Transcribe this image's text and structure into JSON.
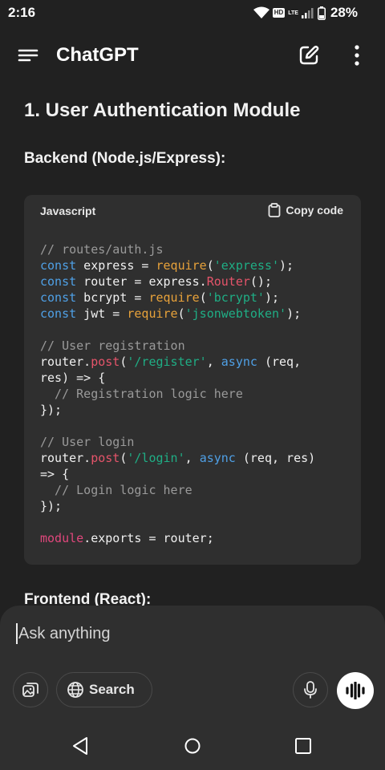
{
  "status_bar": {
    "time": "2:16",
    "hd": "HD",
    "lte": "LTE",
    "battery": "28%",
    "icons": [
      "wifi-icon",
      "signal-icon",
      "battery-icon"
    ]
  },
  "header": {
    "title": "ChatGPT",
    "icons": [
      "menu-icon",
      "new-chat-icon",
      "more-vert-icon"
    ]
  },
  "message": {
    "heading": "1. User Authentication Module",
    "subheading_backend": "Backend (Node.js/Express):",
    "code_block": {
      "language": "Javascript",
      "copy_label": "Copy code",
      "lines": [
        [
          [
            "c",
            "// routes/auth.js"
          ]
        ],
        [
          [
            "k",
            "const"
          ],
          [
            "p",
            " express = "
          ],
          [
            "f",
            "require"
          ],
          [
            "p",
            "("
          ],
          [
            "s",
            "'express'"
          ],
          [
            "p",
            ");"
          ]
        ],
        [
          [
            "k",
            "const"
          ],
          [
            "p",
            " router = express."
          ],
          [
            "r",
            "Router"
          ],
          [
            "p",
            "();"
          ]
        ],
        [
          [
            "k",
            "const"
          ],
          [
            "p",
            " bcrypt = "
          ],
          [
            "f",
            "require"
          ],
          [
            "p",
            "("
          ],
          [
            "s",
            "'bcrypt'"
          ],
          [
            "p",
            ");"
          ]
        ],
        [
          [
            "k",
            "const"
          ],
          [
            "p",
            " jwt = "
          ],
          [
            "f",
            "require"
          ],
          [
            "p",
            "("
          ],
          [
            "s",
            "'jsonwebtoken'"
          ],
          [
            "p",
            ");"
          ]
        ],
        [
          [
            "p",
            ""
          ]
        ],
        [
          [
            "c",
            "// User registration"
          ]
        ],
        [
          [
            "p",
            "router."
          ],
          [
            "r",
            "post"
          ],
          [
            "p",
            "("
          ],
          [
            "s",
            "'/register'"
          ],
          [
            "p",
            ", "
          ],
          [
            "k",
            "async"
          ],
          [
            "p",
            " (req,"
          ]
        ],
        [
          [
            "p",
            "res) => {"
          ]
        ],
        [
          [
            "c",
            "  // Registration logic here"
          ]
        ],
        [
          [
            "p",
            "});"
          ]
        ],
        [
          [
            "p",
            ""
          ]
        ],
        [
          [
            "c",
            "// User login"
          ]
        ],
        [
          [
            "p",
            "router."
          ],
          [
            "r",
            "post"
          ],
          [
            "p",
            "("
          ],
          [
            "s",
            "'/login'"
          ],
          [
            "p",
            ", "
          ],
          [
            "k",
            "async"
          ],
          [
            "p",
            " (req, res)"
          ]
        ],
        [
          [
            "p",
            "=> {"
          ]
        ],
        [
          [
            "c",
            "  // Login logic here"
          ]
        ],
        [
          [
            "p",
            "});"
          ]
        ],
        [
          [
            "p",
            ""
          ]
        ],
        [
          [
            "m",
            "module"
          ],
          [
            "p",
            ".exports = router;"
          ]
        ]
      ]
    },
    "subheading_frontend": "Frontend (React):"
  },
  "composer": {
    "placeholder": "Ask anything",
    "search_label": "Search",
    "icons": [
      "attach-image-icon",
      "globe-icon",
      "mic-icon",
      "voice-mode-icon"
    ]
  },
  "nav_bar": {
    "icons": [
      "back-icon",
      "home-icon",
      "recents-icon"
    ]
  },
  "colors": {
    "background": "#212121",
    "code_background": "#2f2f2f",
    "keyword": "#4fa0e6",
    "function": "#e8a23a",
    "string": "#1fae85",
    "class": "#e5546a",
    "comment": "#9a9a9a"
  }
}
